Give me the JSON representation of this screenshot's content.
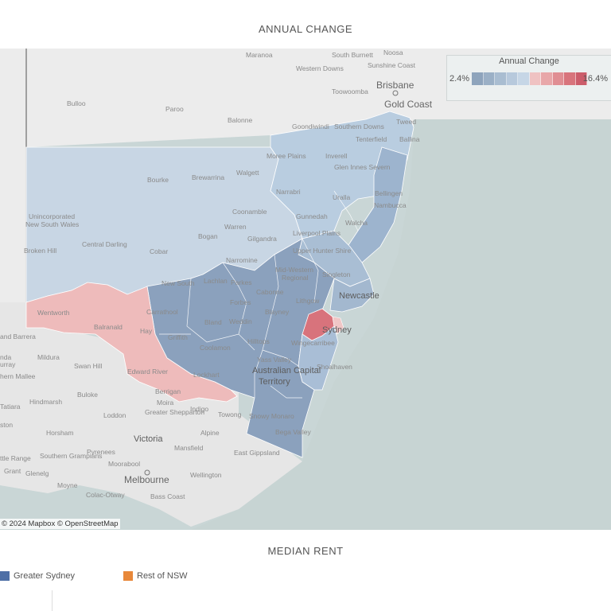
{
  "top_title": "ANNUAL CHANGE",
  "bottom_title": "MEDIAN RENT",
  "legend": {
    "title": "Annual Change",
    "min_label": "2.4%",
    "max_label": "16.4%",
    "colors": [
      "#8ea4bc",
      "#9bb0c6",
      "#a9bdd1",
      "#b7c9dc",
      "#c6d6e6",
      "#efc2c2",
      "#e8a7a9",
      "#e08e93",
      "#d8747c",
      "#cc5d6b"
    ]
  },
  "attribution": "© 2024 Mapbox  © OpenStreetMap",
  "series_legend": [
    {
      "label": "Greater Sydney",
      "color": "#4e6fa6"
    },
    {
      "label": "Rest of NSW",
      "color": "#e8883a"
    }
  ],
  "map_labels": {
    "maranoa": "Maranoa",
    "south_burnett": "South Burnett",
    "noosa": "Noosa",
    "sunshine_coast": "Sunshine Coast",
    "western_downs": "Western Downs",
    "brisbane": "Brisbane",
    "toowoomba": "Toowoomba",
    "gold_coast": "Gold Coast",
    "bulloo": "Bulloo",
    "paroo": "Paroo",
    "balonne": "Balonne",
    "goondiwindi": "Goondiwindi",
    "southern_downs": "Southern Downs",
    "tweed": "Tweed",
    "tenterfield": "Tenterfield",
    "ballina": "Ballina",
    "moree_plains": "Moree Plains",
    "inverell": "Inverell",
    "glen_innes_severn": "Glen Innes Severn",
    "bourke": "Bourke",
    "brewarrina": "Brewarrina",
    "walgett": "Walgett",
    "narrabri": "Narrabri",
    "uralla": "Uralla",
    "bellingen": "Bellingen",
    "nambucca": "Nambucca",
    "unincorporated": "Unincorporated",
    "new_south_wales": "New South Wales",
    "coonamble": "Coonamble",
    "gunnedah": "Gunnedah",
    "walcha": "Walcha",
    "warren": "Warren",
    "gilgandra": "Gilgandra",
    "liverpool_plains": "Liverpool Plains",
    "bogan": "Bogan",
    "broken_hill": "Broken Hill",
    "central_darling": "Central Darling",
    "cobar": "Cobar",
    "narromine": "Narromine",
    "upper_hunter_shire": "Upper Hunter Shire",
    "mid_western_regional": "Mid-Western",
    "regional": "Regional",
    "singleton": "Singleton",
    "new_south_wales_mid": "New South",
    "lachlan": "Lachlan",
    "parkes": "Parkes",
    "cabonne": "Cabonne",
    "lithgow": "Lithgow",
    "newcastle": "Newcastle",
    "wentworth": "Wentworth",
    "carrathool": "Carrathool",
    "forbes": "Forbes",
    "blayney": "Blayney",
    "balranald": "Balranald",
    "bland": "Bland",
    "weddin": "Weddin",
    "sydney": "Sydney",
    "hay": "Hay",
    "griffith": "Griffith",
    "hilltops": "Hilltops",
    "wingecarribee": "Wingecarribee",
    "mildura": "Mildura",
    "coolamon": "Coolamon",
    "yass_valley": "Yass Valley",
    "shoalhaven": "Shoalhaven",
    "swan_hill": "Swan Hill",
    "edward_river": "Edward River",
    "lockhart": "Lockhart",
    "australian_capital": "Australian Capital",
    "territory": "Territory",
    "buloke": "Buloke",
    "berrigan": "Berrigan",
    "hindmarsh": "Hindmarsh",
    "moira": "Moira",
    "indigo": "Indigo",
    "loddon": "Loddon",
    "greater_shepparton": "Greater Shepparton",
    "towong": "Towong",
    "snowy_monaro": "Snowy Monaro",
    "horsham": "Horsham",
    "alpine": "Alpine",
    "bega_valley": "Bega Valley",
    "victoria": "Victoria",
    "southern_grampians": "Southern Grampians",
    "pyrenees": "Pyrenees",
    "mansfield": "Mansfield",
    "east_gippsland": "East Gippsland",
    "moorabool": "Moorabool",
    "glenelg": "Glenelg",
    "melbourne": "Melbourne",
    "wellington": "Wellington",
    "moyne": "Moyne",
    "colac_otway": "Colac-Otway",
    "bass_coast": "Bass Coast",
    "and_barrera": "and Barrera",
    "nda": "nda",
    "urray": "urray",
    "hern_mallee": "hern Mallee",
    "tatiara": "Tatiara",
    "ston": "ston",
    "ttle_range": "ttle Range",
    "grant": "Grant"
  }
}
